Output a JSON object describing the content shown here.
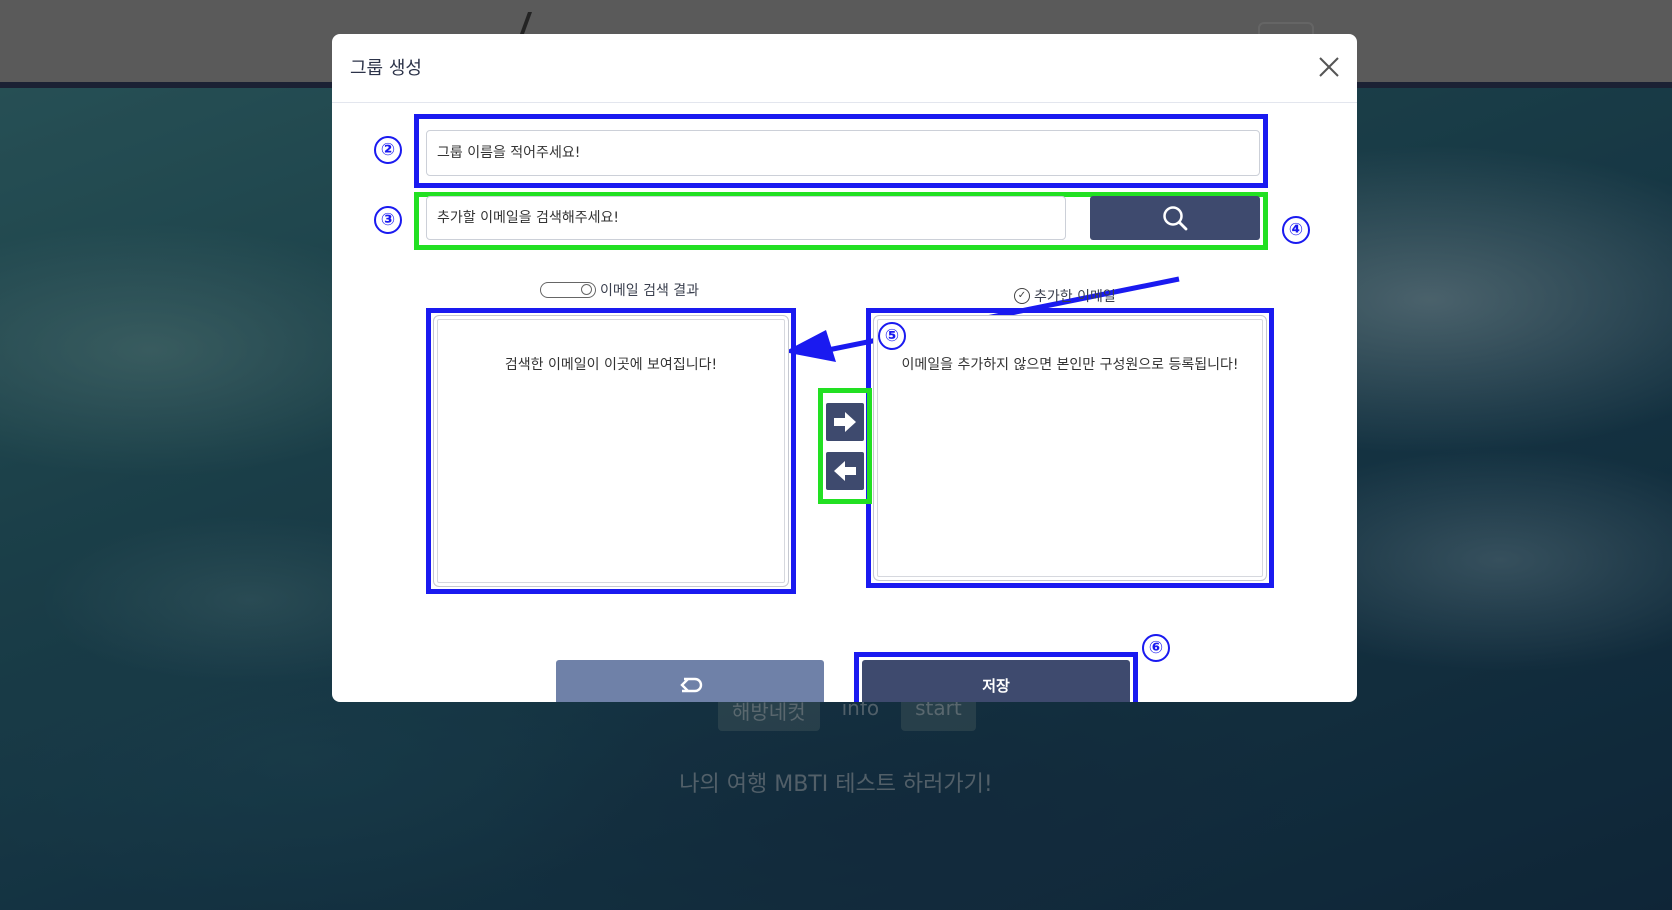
{
  "background": {
    "buttons": [
      {
        "label": "해방네컷"
      },
      {
        "label": "info"
      },
      {
        "label": "start"
      }
    ],
    "caption": "나의 여행 MBTI 테스트 하러가기!"
  },
  "modal": {
    "title": "그룹 생성",
    "close_icon": "close-icon",
    "group_name": {
      "placeholder": "그룹 이름을 적어주세요!",
      "value": ""
    },
    "email_search": {
      "placeholder": "추가할 이메일을 검색해주세요!",
      "value": "",
      "button_icon": "search-icon"
    },
    "search_results": {
      "label": "이메일 검색 결과",
      "empty_message": "검색한 이메일이 이곳에 보여집니다!"
    },
    "added_emails": {
      "label": "추가한 이메일",
      "empty_message": "이메일을 추가하지 않으면 본인만 구성원으로 등록됩니다!"
    },
    "move_right_icon": "arrow-right-icon",
    "move_left_icon": "arrow-left-icon",
    "back_button_icon": "return-icon",
    "save_label": "저장"
  },
  "annotations": [
    "②",
    "③",
    "④",
    "⑤",
    "⑥"
  ],
  "colors": {
    "accent": "#3e4a6e",
    "secondary_button": "#6f81a8",
    "annotation_blue": "#1a1af0",
    "annotation_green": "#22e022"
  }
}
